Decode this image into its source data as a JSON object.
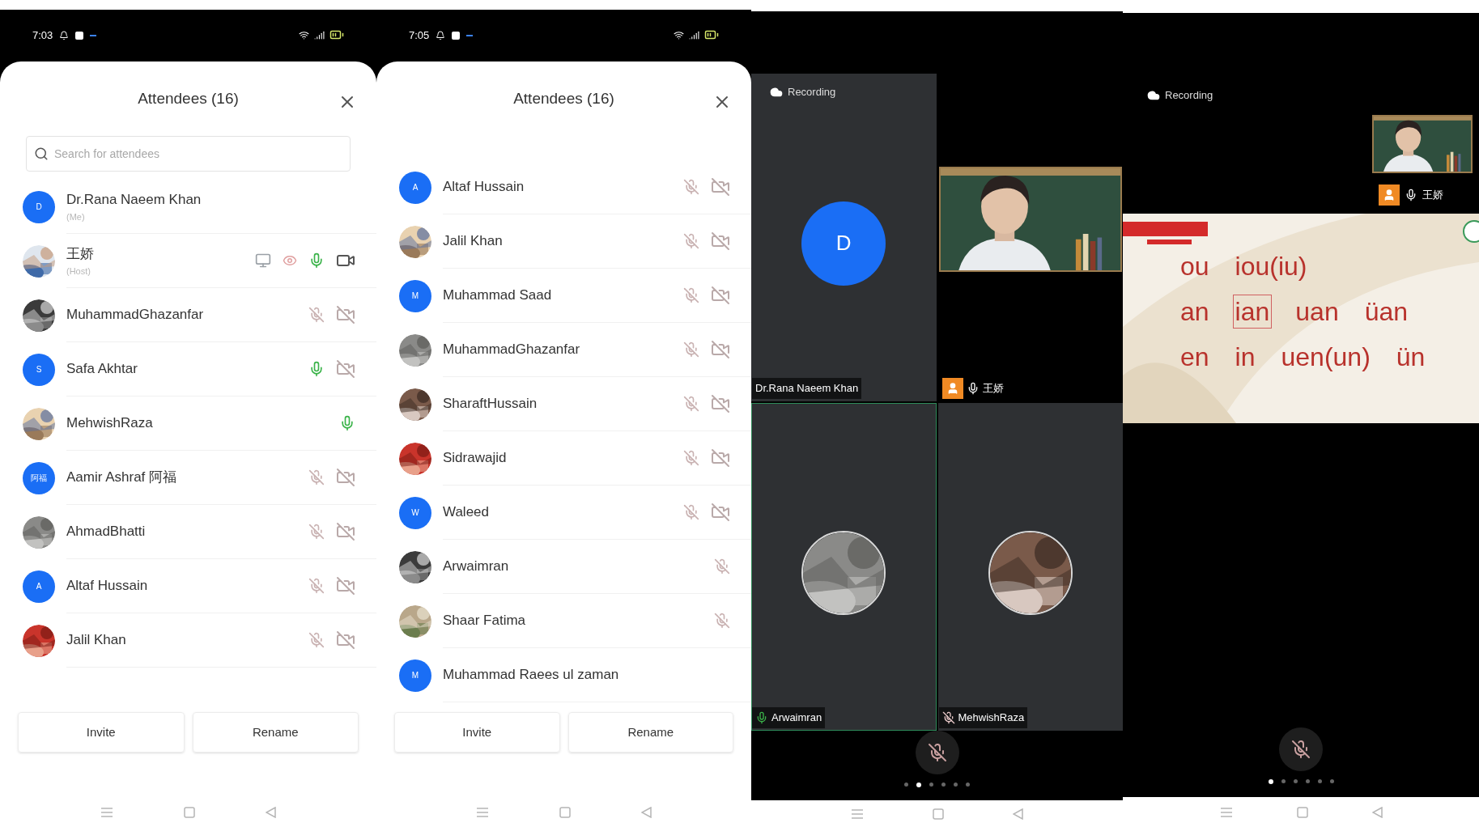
{
  "phones": [
    {
      "kind": "attendees",
      "status_time": "7:03",
      "title": "Attendees (16)",
      "search": {
        "placeholder": "Search for attendees"
      },
      "attendees": [
        {
          "name": "Dr.Rana Naeem Khan",
          "subtitle": "(Me)",
          "kind": "initial",
          "initial": "D"
        },
        {
          "name": "王娇",
          "subtitle": "(Host)",
          "kind": "picture",
          "muted": false,
          "video_on": true,
          "host_tools": true
        },
        {
          "name": "MuhammadGhazanfar",
          "kind": "picture",
          "muted": true,
          "video_on": false
        },
        {
          "name": "Safa Akhtar",
          "kind": "initial",
          "initial": "S",
          "muted": false,
          "video_on": false
        },
        {
          "name": "MehwishRaza",
          "kind": "picture",
          "muted": false
        },
        {
          "name": "Aamir Ashraf 阿福",
          "kind": "initial",
          "initial": "阿福",
          "muted": true,
          "video_on": false
        },
        {
          "name": "AhmadBhatti",
          "kind": "picture",
          "muted": true,
          "video_on": false
        },
        {
          "name": "Altaf Hussain",
          "kind": "initial",
          "initial": "A",
          "muted": true,
          "video_on": false
        },
        {
          "name": "Jalil Khan",
          "kind": "picture",
          "muted": true,
          "video_on": false
        }
      ],
      "buttons": [
        "Invite",
        "Rename"
      ]
    },
    {
      "kind": "attendees",
      "status_time": "7:05",
      "title": "Attendees (16)",
      "attendees": [
        {
          "name": "Altaf Hussain",
          "kind": "initial",
          "initial": "A",
          "muted": true,
          "video_on": false
        },
        {
          "name": "Jalil Khan",
          "kind": "picture",
          "muted": true,
          "video_on": false
        },
        {
          "name": "Muhammad Saad",
          "kind": "initial",
          "initial": "M",
          "muted": true,
          "video_on": false
        },
        {
          "name": "MuhammadGhazanfar",
          "kind": "picture",
          "muted": true,
          "video_on": false
        },
        {
          "name": "SharaftHussain",
          "kind": "picture",
          "muted": true,
          "video_on": false
        },
        {
          "name": "Sidrawajid",
          "kind": "picture",
          "muted": true,
          "video_on": false
        },
        {
          "name": "Waleed",
          "kind": "initial",
          "initial": "W",
          "muted": true,
          "video_on": false
        },
        {
          "name": "Arwaimran",
          "kind": "picture",
          "muted": true
        },
        {
          "name": "Shaar Fatima",
          "kind": "picture",
          "muted": true
        },
        {
          "name": "Muhammad Raees ul zaman",
          "kind": "initial",
          "initial": "M"
        }
      ],
      "buttons": [
        "Invite",
        "Rename"
      ]
    },
    {
      "kind": "gallery",
      "recording": "Recording",
      "tiles": [
        {
          "name": "Dr.Rana Naeem Khan",
          "kind": "initial",
          "initial": "D",
          "speaking": false
        },
        {
          "name": "王娇",
          "kind": "video",
          "muted": false,
          "speaking": false,
          "host_badge": true
        },
        {
          "name": "Arwaimran",
          "kind": "picture",
          "muted": false,
          "speaking": true
        },
        {
          "name": "MehwishRaza",
          "kind": "picture",
          "muted": true,
          "speaking": false
        }
      ],
      "pages": [
        {
          "selected": false
        },
        {
          "selected": true
        },
        {
          "selected": false
        },
        {
          "selected": false
        },
        {
          "selected": false
        },
        {
          "selected": false
        }
      ]
    },
    {
      "kind": "share",
      "recording": "Recording",
      "host_label": "王娇",
      "slide": {
        "lines": [
          [
            {
              "text": "ou",
              "boxed": false
            },
            {
              "text": "iou(iu)",
              "boxed": false
            }
          ],
          [
            {
              "text": "an",
              "boxed": false
            },
            {
              "text": "ian",
              "boxed": true
            },
            {
              "text": "uan",
              "boxed": false
            },
            {
              "text": "üan",
              "boxed": false
            }
          ],
          [
            {
              "text": "en",
              "boxed": false
            },
            {
              "text": "in",
              "boxed": false
            },
            {
              "text": "uen(un)",
              "boxed": false
            },
            {
              "text": "ün",
              "boxed": false
            }
          ]
        ]
      },
      "pages": [
        {
          "selected": true
        },
        {
          "selected": false
        },
        {
          "selected": false
        },
        {
          "selected": false
        },
        {
          "selected": false
        },
        {
          "selected": false
        }
      ]
    }
  ]
}
